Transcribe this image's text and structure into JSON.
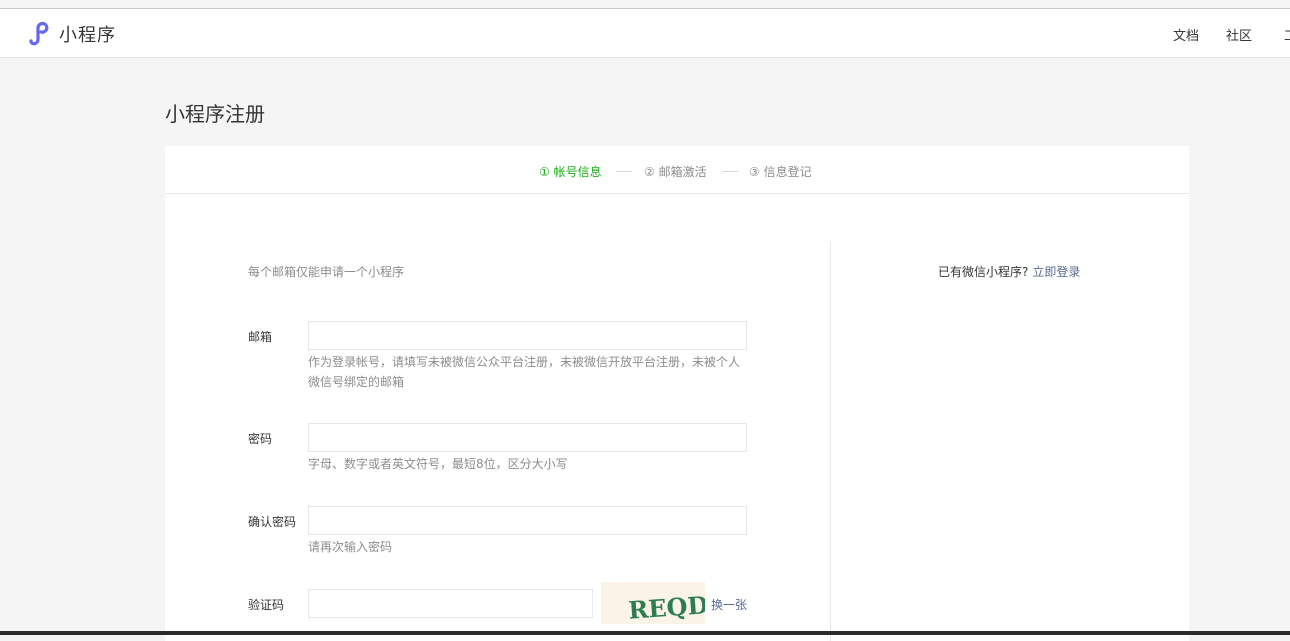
{
  "header": {
    "brand": "小程序",
    "nav": [
      {
        "label": "文档"
      },
      {
        "label": "社区"
      },
      {
        "label": "工"
      }
    ]
  },
  "page_title": "小程序注册",
  "steps": [
    {
      "label": "① 帐号信息",
      "active": true
    },
    {
      "label": "② 邮箱激活",
      "active": false
    },
    {
      "label": "③ 信息登记",
      "active": false
    }
  ],
  "form": {
    "notice": "每个邮箱仅能申请一个小程序",
    "email": {
      "label": "邮箱",
      "value": "",
      "hint": "作为登录帐号，请填写未被微信公众平台注册，未被微信开放平台注册，未被个人微信号绑定的邮箱"
    },
    "password": {
      "label": "密码",
      "value": "",
      "hint": "字母、数字或者英文符号，最短8位，区分大小写"
    },
    "confirm": {
      "label": "确认密码",
      "value": "",
      "hint": "请再次输入密码"
    },
    "captcha": {
      "label": "验证码",
      "value": "",
      "image_text": "REQD",
      "refresh_label": "换一张"
    }
  },
  "sidebar": {
    "question": "已有微信小程序?",
    "login_link": "立即登录"
  },
  "colors": {
    "accent_green": "#1aad19",
    "link_blue": "#576b95",
    "logo_purple": "#6467f0"
  }
}
